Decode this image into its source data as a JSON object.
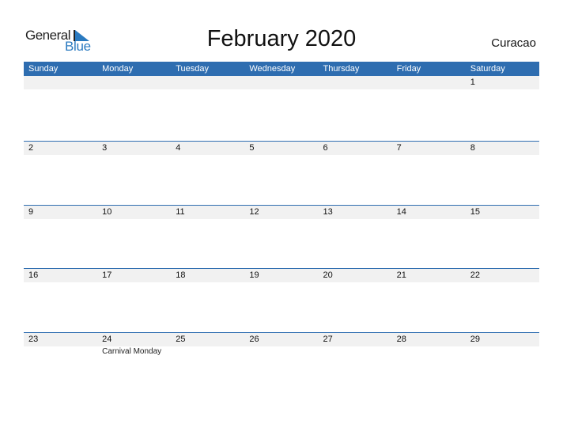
{
  "logo": {
    "line1": "General",
    "line2": "Blue"
  },
  "title": "February 2020",
  "country": "Curacao",
  "colors": {
    "header": "#2e6db0",
    "strip": "#f1f1f1",
    "accent": "#2a7ac0"
  },
  "weekdays": [
    "Sunday",
    "Monday",
    "Tuesday",
    "Wednesday",
    "Thursday",
    "Friday",
    "Saturday"
  ],
  "weeks": [
    [
      "",
      "",
      "",
      "",
      "",
      "",
      "1"
    ],
    [
      "2",
      "3",
      "4",
      "5",
      "6",
      "7",
      "8"
    ],
    [
      "9",
      "10",
      "11",
      "12",
      "13",
      "14",
      "15"
    ],
    [
      "16",
      "17",
      "18",
      "19",
      "20",
      "21",
      "22"
    ],
    [
      "23",
      "24",
      "25",
      "26",
      "27",
      "28",
      "29"
    ]
  ],
  "events": [
    {
      "date": "24",
      "label": "Carnival Monday"
    }
  ]
}
